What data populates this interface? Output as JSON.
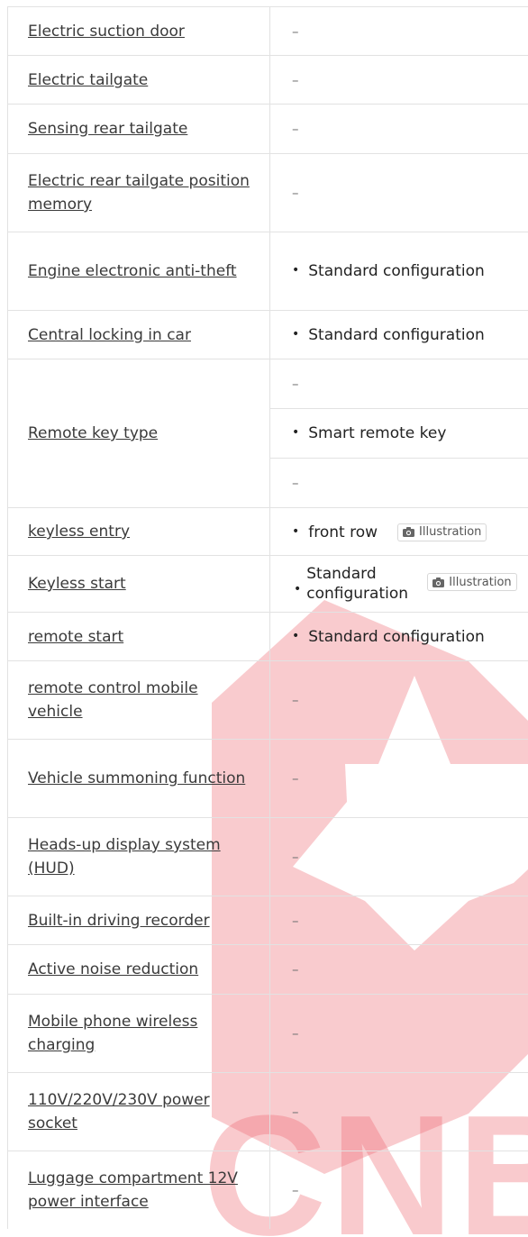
{
  "watermark": {
    "text": "CNBI",
    "color": "#e0434f"
  },
  "illustration_label": "Illustration",
  "rows": [
    {
      "label": "Electric suction door",
      "values": [
        "–"
      ]
    },
    {
      "label": "Electric tailgate",
      "values": [
        "–"
      ]
    },
    {
      "label": "Sensing rear tailgate",
      "values": [
        "–"
      ]
    },
    {
      "label": "Electric rear tailgate position memory",
      "values": [
        "–"
      ]
    },
    {
      "label": "Engine electronic anti-theft",
      "values": [
        "Standard configuration"
      ]
    },
    {
      "label": "Central locking in car",
      "values": [
        "Standard configuration"
      ]
    },
    {
      "label": "Remote key type",
      "values": [
        "–",
        "Smart remote key",
        "–"
      ]
    },
    {
      "label": "keyless entry",
      "values": [
        "front row"
      ]
    },
    {
      "label": "Keyless start",
      "values": [
        "Standard configuration"
      ]
    },
    {
      "label": "remote start",
      "values": [
        "Standard configuration"
      ]
    },
    {
      "label": "remote control mobile vehicle",
      "values": [
        "–"
      ]
    },
    {
      "label": "Vehicle summoning function",
      "values": [
        "–"
      ]
    },
    {
      "label": "Heads-up display system (HUD)",
      "values": [
        "–"
      ]
    },
    {
      "label": "Built-in driving recorder",
      "values": [
        "–"
      ]
    },
    {
      "label": "Active noise reduction",
      "values": [
        "–"
      ]
    },
    {
      "label": "Mobile phone wireless charging",
      "values": [
        "–"
      ]
    },
    {
      "label": "110V/220V/230V power socket",
      "values": [
        "–"
      ]
    },
    {
      "label": "Luggage compartment 12V power interface",
      "values": [
        "–"
      ]
    }
  ]
}
